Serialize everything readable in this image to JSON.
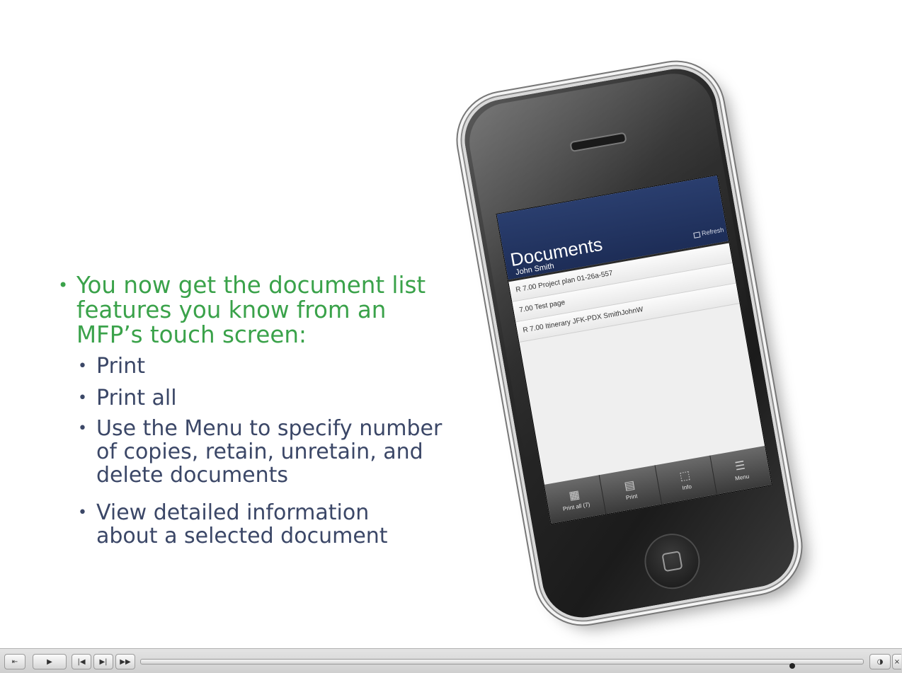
{
  "slide": {
    "bullet_main": "You now get the document list features you know from an MFP’s touch screen:",
    "main_lines": [
      "You now get the document list",
      "features you know from an",
      "MFP’s touch screen:"
    ],
    "sub_bullets": [
      {
        "lines": [
          "Print"
        ]
      },
      {
        "lines": [
          "Print all"
        ]
      },
      {
        "lines": [
          "Use the Menu to specify number",
          "of copies, retain, unretain, and",
          "delete documents"
        ]
      },
      {
        "lines": [
          "View detailed information",
          "about a selected document"
        ]
      }
    ],
    "colors": {
      "main_bullet": "#3aa24a",
      "sub_bullet": "#3b4767"
    }
  },
  "phone": {
    "screen_title": "Documents",
    "user": "John Smith",
    "refresh_label": "Refresh",
    "documents": [
      "R 7.00  Project plan 01-26a-557",
      "7.00  Test page",
      "R 7.00  Itinerary JFK-PDX SmithJohnW"
    ],
    "toolbar": [
      {
        "label": "Print all (7)",
        "icon": "print-all-icon",
        "glyph": "▦"
      },
      {
        "label": "Print",
        "icon": "print-icon",
        "glyph": "▤"
      },
      {
        "label": "Info",
        "icon": "info-icon",
        "glyph": "⬚"
      },
      {
        "label": "Menu",
        "icon": "menu-icon",
        "glyph": "☰"
      }
    ],
    "header_color": "#1d2d57"
  },
  "player": {
    "buttons": [
      {
        "name": "exit-button",
        "glyph": "⇤"
      },
      {
        "name": "play-button",
        "glyph": "▶"
      },
      {
        "name": "skip-to-start-button",
        "glyph": "|◀"
      },
      {
        "name": "previous-slide-button",
        "glyph": "▶|"
      },
      {
        "name": "next-slide-button",
        "glyph": "▶▶"
      }
    ],
    "progress": 0.903,
    "right_buttons": [
      {
        "name": "volume-button",
        "glyph": "◑"
      },
      {
        "name": "close-button",
        "glyph": "×"
      }
    ]
  }
}
